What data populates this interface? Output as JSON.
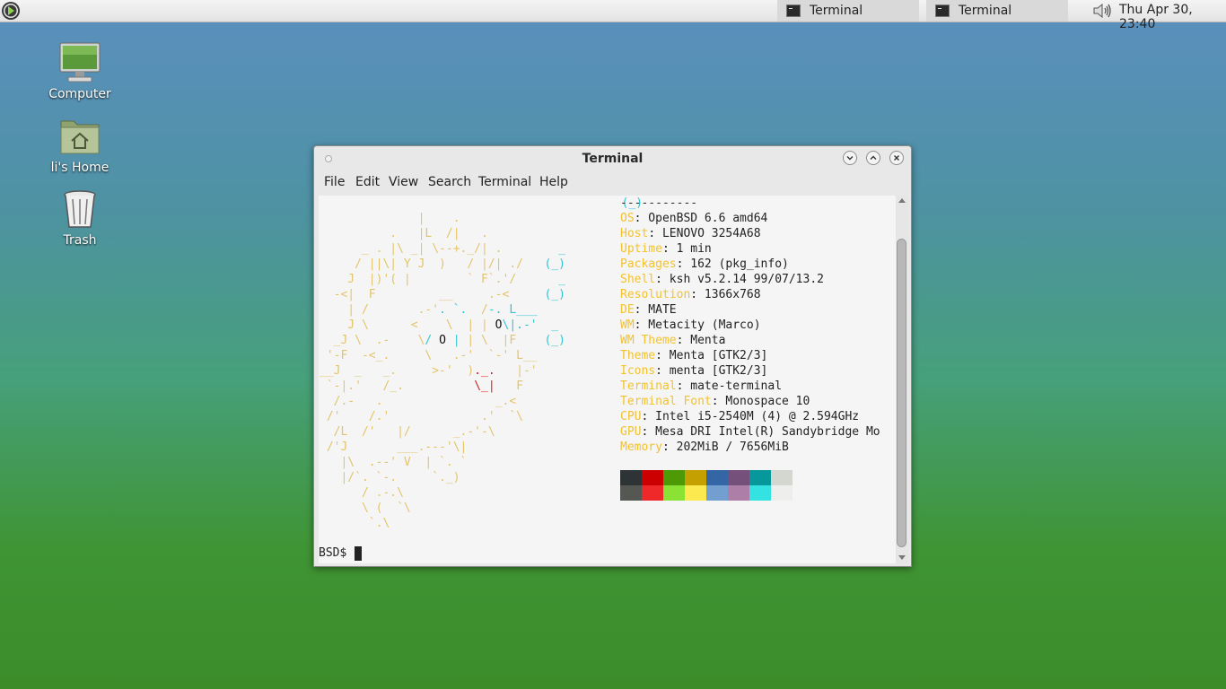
{
  "panel": {
    "tasks": [
      {
        "label": "Terminal"
      },
      {
        "label": "Terminal"
      }
    ],
    "clock": "Thu Apr 30, 23:40"
  },
  "desktop": {
    "icons": [
      {
        "label": "Computer"
      },
      {
        "label": "li's Home"
      },
      {
        "label": "Trash"
      }
    ]
  },
  "window": {
    "title": "Terminal",
    "menu": [
      "File",
      "Edit",
      "View",
      "Search",
      "Terminal",
      "Help"
    ]
  },
  "terminal": {
    "separator": "-----------",
    "info": [
      {
        "key": "OS",
        "value": ": OpenBSD 6.6 amd64"
      },
      {
        "key": "Host",
        "value": ": LENOVO 3254A68"
      },
      {
        "key": "Uptime",
        "value": ": 1 min"
      },
      {
        "key": "Packages",
        "value": ": 162 (pkg_info)"
      },
      {
        "key": "Shell",
        "value": ": ksh v5.2.14 99/07/13.2"
      },
      {
        "key": "Resolution",
        "value": ": 1366x768"
      },
      {
        "key": "DE",
        "value": ": MATE"
      },
      {
        "key": "WM",
        "value": ": Metacity (Marco)"
      },
      {
        "key": "WM Theme",
        "value": ": Menta"
      },
      {
        "key": "Theme",
        "value": ": Menta [GTK2/3]"
      },
      {
        "key": "Icons",
        "value": ": menta [GTK2/3]"
      },
      {
        "key": "Terminal",
        "value": ": mate-terminal"
      },
      {
        "key": "Terminal Font",
        "value": ": Monospace 10"
      },
      {
        "key": "CPU",
        "value": ": Intel i5-2540M (4) @ 2.594GHz"
      },
      {
        "key": "GPU",
        "value": ": Mesa DRI Intel(R) Sandybridge Mo"
      },
      {
        "key": "Memory",
        "value": ": 202MiB / 7656MiB"
      }
    ],
    "palette_top": [
      "#2e3436",
      "#cc0000",
      "#4e9a06",
      "#c4a000",
      "#3465a4",
      "#75507b",
      "#06989a",
      "#d3d7cf"
    ],
    "palette_bottom": [
      "#555753",
      "#ef2929",
      "#8ae234",
      "#fce94f",
      "#729fcf",
      "#ad7fa8",
      "#34e2e2",
      "#eeeeec"
    ],
    "prompt": "BSD$ "
  }
}
